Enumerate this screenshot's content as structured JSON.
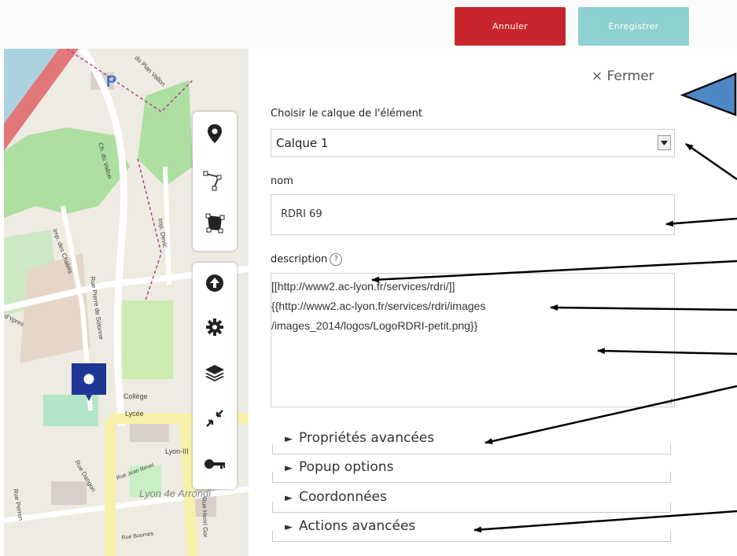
{
  "header": {
    "cancel_label": "Annuler",
    "save_label": "Enregistrer"
  },
  "colors": {
    "cancel": "#c9252c",
    "save": "#8fd0d1",
    "marker": "#1f3794",
    "annotation_triangle": "#4f87c6"
  },
  "map": {
    "labels": {
      "parking": "P",
      "college": "Collège",
      "lycee": "Lycée",
      "lyon3": "Lyon-III",
      "arrondissement": "Lyon 4e Arrondi",
      "rue_perron": "Rue Perron",
      "rue_jean_revel": "Rue Jean Revel",
      "rue_bournes": "Rue Bournes",
      "rue_henri": "Rue Henri Gor",
      "rue_dangon": "Rue Dangon",
      "imp_chalets": "Imp. des Chalets",
      "imp_devic": "Imp. Devic",
      "ch_vallon": "Ch. du Vallon",
      "plan_vallon": "du Plan Vallon",
      "ypres": "d'Ypres",
      "rue_pierre": "Rue Pierre de Solonne"
    }
  },
  "toolbar": {
    "group1": [
      "marker-icon",
      "polyline-icon",
      "polygon-icon"
    ],
    "group2": [
      "upload-icon",
      "gear-icon",
      "layers-icon",
      "collapse-icon",
      "key-icon"
    ]
  },
  "panel": {
    "close_label": "× Fermer",
    "layer_label": "Choisir le calque de l'élément",
    "layer_value": "Calque 1",
    "name_label": "nom",
    "name_value": "RDRI 69",
    "description_label": "description",
    "help_glyph": "?",
    "description_lines": [
      "[[http://www2.ac-lyon.fr/services/rdri/]]",
      "{{http://www2.ac-lyon.fr/services/rdri/images",
      "/images_2014/logos/LogoRDRI-petit.png}}"
    ],
    "sections": [
      "Propriétés avancées",
      "Popup options",
      "Coordonnées",
      "Actions avancées"
    ],
    "section_glyph": "►"
  }
}
